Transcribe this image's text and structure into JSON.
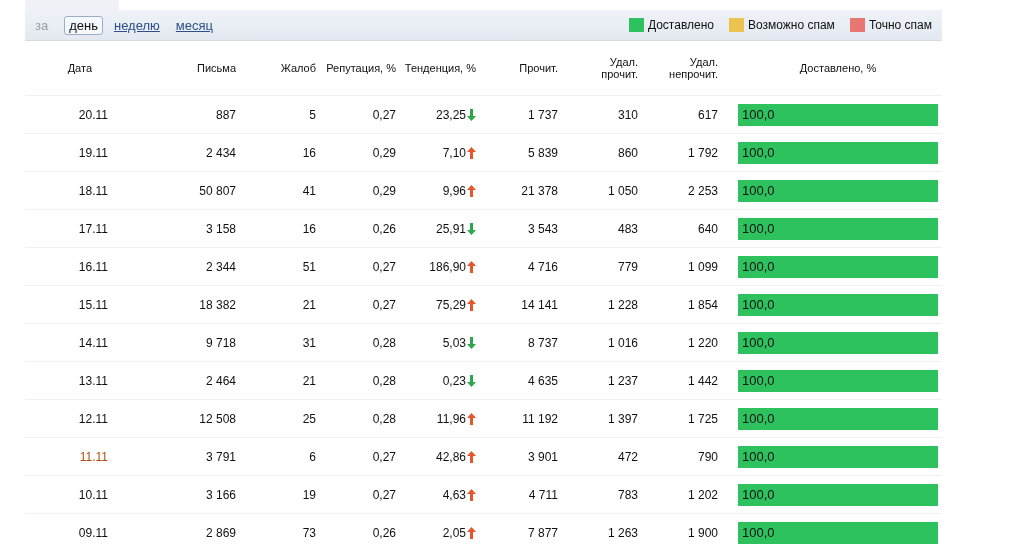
{
  "period": {
    "label": "за",
    "options": [
      {
        "label": "день",
        "selected": true
      },
      {
        "label": "неделю",
        "selected": false
      },
      {
        "label": "месяц",
        "selected": false
      }
    ]
  },
  "legend": [
    {
      "label": "Доставлено",
      "color": "#2dc25e"
    },
    {
      "label": "Возможно спам",
      "color": "#ebc34e"
    },
    {
      "label": "Точно спам",
      "color": "#e87774"
    }
  ],
  "columns": [
    "Дата",
    "Письма",
    "Жалоб",
    "Репутация, %",
    "Тенденция, %",
    "Прочит.",
    "Удал. прочит.",
    "Удал. непрочит.",
    "Доставлено, %"
  ],
  "rows": [
    {
      "date": "20.11",
      "holiday": false,
      "letters": "887",
      "complaints": "5",
      "reputation": "0,27",
      "trend": "23,25",
      "trend_up": false,
      "read": "1 737",
      "deleted_read": "310",
      "deleted_unread": "617",
      "delivered": {
        "level": 1,
        "label": "100,0"
      }
    },
    {
      "date": "19.11",
      "holiday": false,
      "letters": "2 434",
      "complaints": "16",
      "reputation": "0,29",
      "trend": "7,10",
      "trend_up": true,
      "read": "5 839",
      "deleted_read": "860",
      "deleted_unread": "1 792",
      "delivered": {
        "level": 1,
        "label": "100,0"
      }
    },
    {
      "date": "18.11",
      "holiday": false,
      "letters": "50 807",
      "complaints": "41",
      "reputation": "0,29",
      "trend": "9,96",
      "trend_up": true,
      "read": "21 378",
      "deleted_read": "1 050",
      "deleted_unread": "2 253",
      "delivered": {
        "level": 1,
        "label": "100,0"
      }
    },
    {
      "date": "17.11",
      "holiday": false,
      "letters": "3 158",
      "complaints": "16",
      "reputation": "0,26",
      "trend": "25,91",
      "trend_up": false,
      "read": "3 543",
      "deleted_read": "483",
      "deleted_unread": "640",
      "delivered": {
        "level": 1,
        "label": "100,0"
      }
    },
    {
      "date": "16.11",
      "holiday": false,
      "letters": "2 344",
      "complaints": "51",
      "reputation": "0,27",
      "trend": "186,90",
      "trend_up": true,
      "read": "4 716",
      "deleted_read": "779",
      "deleted_unread": "1 099",
      "delivered": {
        "level": 1,
        "label": "100,0"
      }
    },
    {
      "date": "15.11",
      "holiday": false,
      "letters": "18 382",
      "complaints": "21",
      "reputation": "0,27",
      "trend": "75,29",
      "trend_up": true,
      "read": "14 141",
      "deleted_read": "1 228",
      "deleted_unread": "1 854",
      "delivered": {
        "level": 1,
        "label": "100,0"
      }
    },
    {
      "date": "14.11",
      "holiday": false,
      "letters": "9 718",
      "complaints": "31",
      "reputation": "0,28",
      "trend": "5,03",
      "trend_up": false,
      "read": "8 737",
      "deleted_read": "1 016",
      "deleted_unread": "1 220",
      "delivered": {
        "level": 1,
        "label": "100,0"
      }
    },
    {
      "date": "13.11",
      "holiday": false,
      "letters": "2 464",
      "complaints": "21",
      "reputation": "0,28",
      "trend": "0,23",
      "trend_up": false,
      "read": "4 635",
      "deleted_read": "1 237",
      "deleted_unread": "1 442",
      "delivered": {
        "level": 1,
        "label": "100,0"
      }
    },
    {
      "date": "12.11",
      "holiday": false,
      "letters": "12 508",
      "complaints": "25",
      "reputation": "0,28",
      "trend": "11,96",
      "trend_up": true,
      "read": "11 192",
      "deleted_read": "1 397",
      "deleted_unread": "1 725",
      "delivered": {
        "level": 1,
        "label": "100,0"
      }
    },
    {
      "date": "11.11",
      "holiday": true,
      "letters": "3 791",
      "complaints": "6",
      "reputation": "0,27",
      "trend": "42,86",
      "trend_up": true,
      "read": "3 901",
      "deleted_read": "472",
      "deleted_unread": "790",
      "delivered": {
        "level": 1,
        "label": "100,0"
      }
    },
    {
      "date": "10.11",
      "holiday": false,
      "letters": "3 166",
      "complaints": "19",
      "reputation": "0,27",
      "trend": "4,63",
      "trend_up": true,
      "read": "4 711",
      "deleted_read": "783",
      "deleted_unread": "1 202",
      "delivered": {
        "level": 1,
        "label": "100,0"
      }
    },
    {
      "date": "09.11",
      "holiday": false,
      "letters": "2 869",
      "complaints": "73",
      "reputation": "0,26",
      "trend": "2,05",
      "trend_up": true,
      "read": "7 877",
      "deleted_read": "1 263",
      "deleted_unread": "1 900",
      "delivered": {
        "level": 1,
        "label": "100,0"
      }
    }
  ]
}
